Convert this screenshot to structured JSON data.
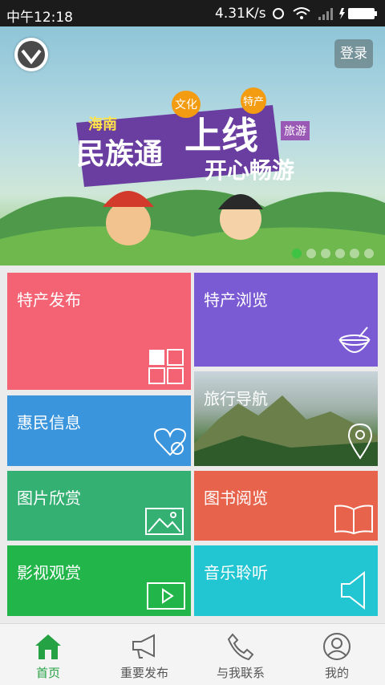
{
  "status_bar": {
    "time": "中午12:18",
    "net_speed": "4.31K/s"
  },
  "banner": {
    "login_label": "登录",
    "slide_count": 6,
    "active_slide": 1,
    "title_small": "海南",
    "title_main": "民族通",
    "title_big": "上线",
    "tag_culture": "文化",
    "tag_special": "特产",
    "tag_travel": "旅游",
    "subtitle": "开心畅游"
  },
  "tiles": {
    "specialty_publish": {
      "label": "特产发布",
      "color": "#f46374"
    },
    "specialty_browse": {
      "label": "特产浏览",
      "color": "#7b5bd4"
    },
    "benefit_info": {
      "label": "惠民信息",
      "color": "#3a95dd"
    },
    "travel_nav": {
      "label": "旅行导航",
      "color": "#5c8b55"
    },
    "picture_view": {
      "label": "图片欣赏",
      "color": "#35b073"
    },
    "book_read": {
      "label": "图书阅览",
      "color": "#e7634b"
    },
    "video_view": {
      "label": "影视观赏",
      "color": "#22b64a"
    },
    "music_listen": {
      "label": "音乐聆听",
      "color": "#22c6d2"
    }
  },
  "nav": {
    "home": "首页",
    "important": "重要发布",
    "contact": "与我联系",
    "mine": "我的",
    "active_color": "#25a244"
  },
  "icons": [
    "grid-icon",
    "coconut-icon",
    "heart-question-icon",
    "location-pin-icon",
    "picture-icon",
    "book-icon",
    "play-icon",
    "speaker-icon",
    "home-icon",
    "megaphone-icon",
    "phone-icon",
    "user-icon"
  ]
}
